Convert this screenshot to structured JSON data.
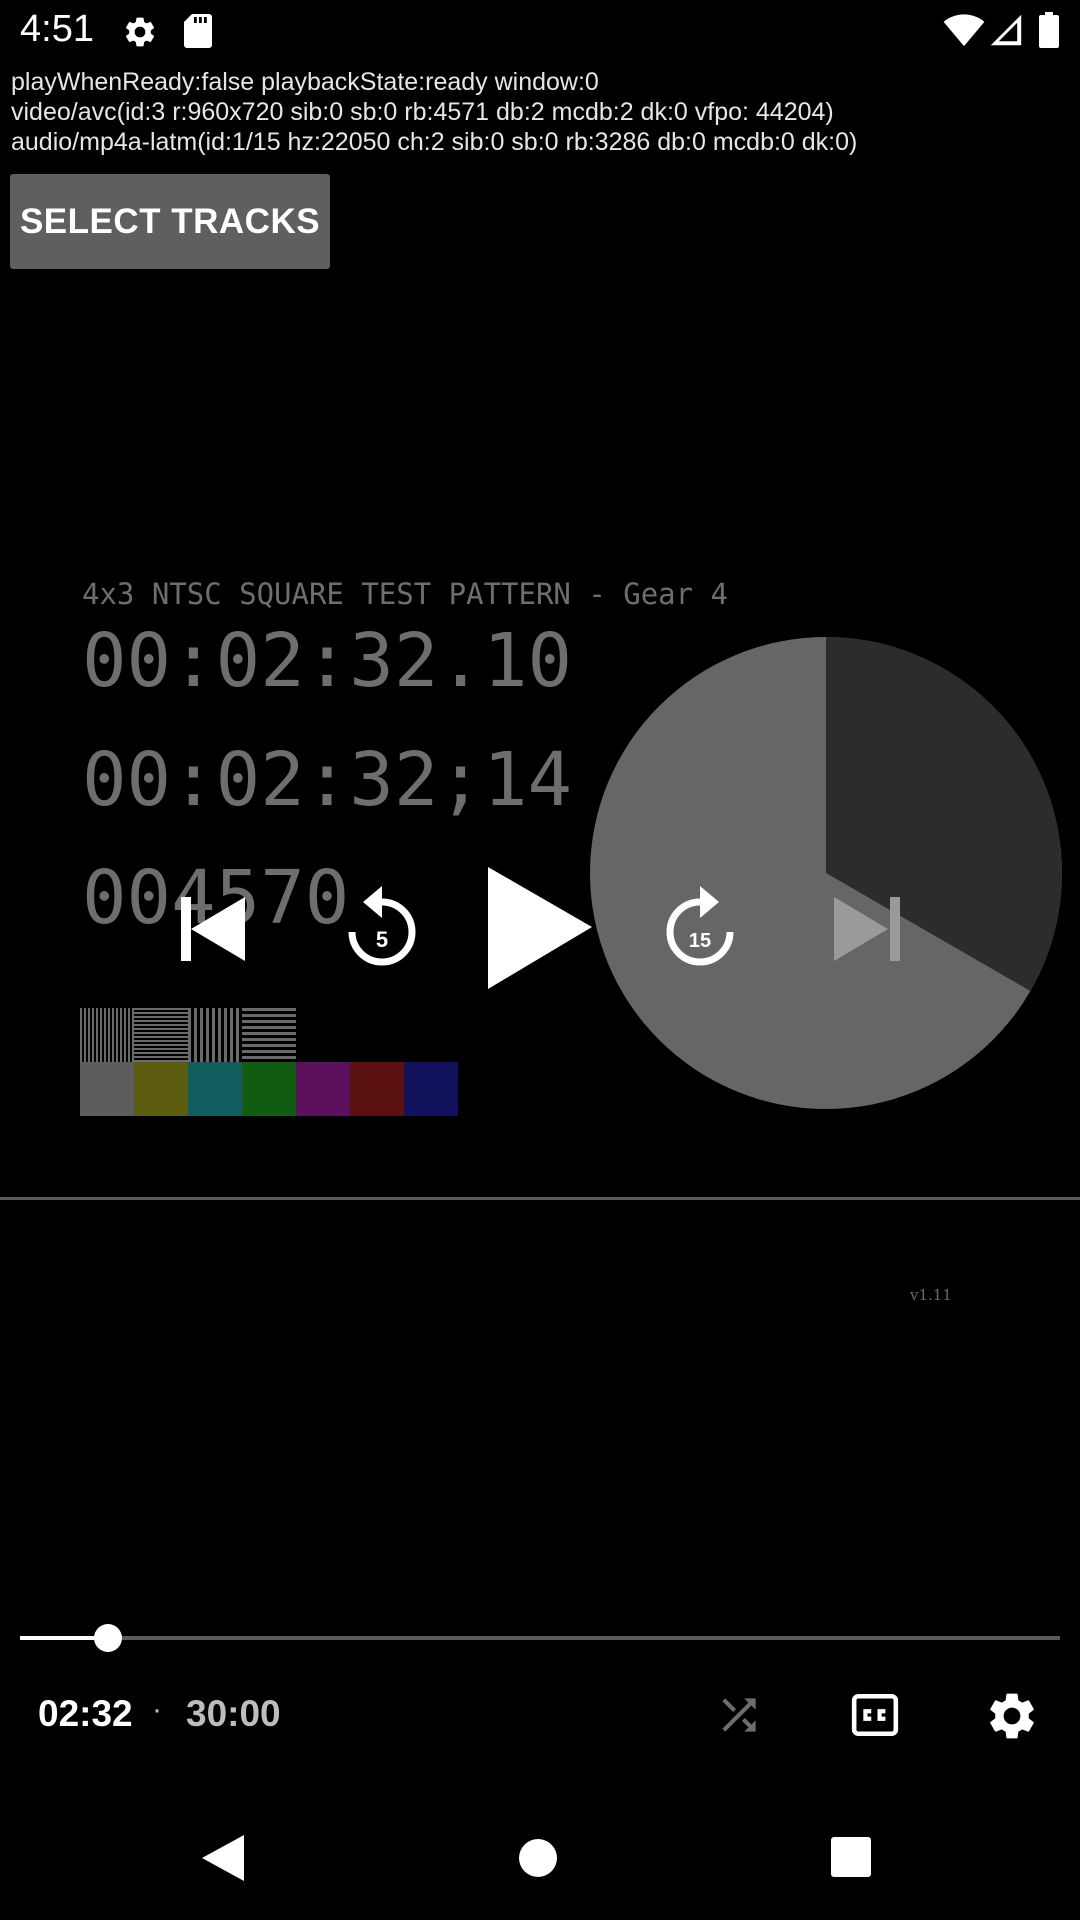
{
  "status_bar": {
    "time": "4:51",
    "icons": [
      "settings-icon",
      "sd-card-icon",
      "wifi-icon",
      "signal-icon",
      "battery-icon"
    ]
  },
  "debug": {
    "line1": "playWhenReady:false playbackState:ready window:0",
    "line2": "video/avc(id:3 r:960x720 sib:0 sb:0 rb:4571 db:2 mcdb:2 dk:0 vfpo: 44204)",
    "line3": "audio/mp4a-latm(id:1/15 hz:22050 ch:2 sib:0 sb:0 rb:3286 db:0 mcdb:0 dk:0)"
  },
  "select_tracks_label": "SELECT TRACKS",
  "video": {
    "pattern_title": "4x3 NTSC SQUARE TEST PATTERN - Gear 4",
    "timecode1": "00:02:32.10",
    "timecode2": "00:02:32;14",
    "frame_count": "004570",
    "version": "v1.11",
    "colors": {
      "pie_light": "#666666",
      "pie_dark": "#2c2c2c",
      "bars": [
        "#5c5c5c",
        "#5c5c11",
        "#115c5c",
        "#115c11",
        "#5c115c",
        "#5c1111",
        "#11115c"
      ]
    }
  },
  "controls": {
    "rewind_seconds": "5",
    "forward_seconds": "15",
    "position": "02:32",
    "separator": "·",
    "duration": "30:00",
    "progress_fraction": 0.0845
  }
}
